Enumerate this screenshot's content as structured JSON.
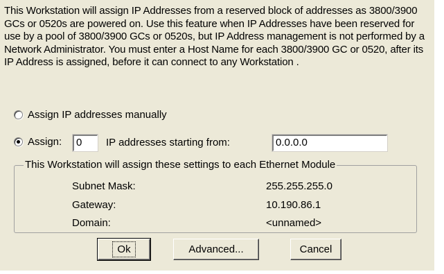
{
  "intro_text": "This Workstation will assign IP Addresses from a reserved block of addresses as 3800/3900 GCs or 0520s are powered on.  Use this feature when IP Addresses have been reserved for use by a pool of 3800/3900 GCs or 0520s, but IP Address management is not performed by a Network Administrator.  You must enter a Host Name for each 3800/3900 GC or 0520, after its IP Address is assigned, before it can connect to any Workstation .",
  "options": {
    "manual_label": "Assign IP addresses manually",
    "manual_selected": false,
    "auto_prefix_label": "Assign:",
    "auto_selected": true,
    "count_value": "0",
    "starting_from_label": "IP addresses starting from:",
    "start_ip_value": "0.0.0.0"
  },
  "settings_group": {
    "title": "This Workstation will assign these settings to each Ethernet Module",
    "rows": [
      {
        "label": "Subnet Mask:",
        "value": "255.255.255.0"
      },
      {
        "label": "Gateway:",
        "value": "10.190.86.1"
      },
      {
        "label": "Domain:",
        "value": "<unnamed>"
      }
    ]
  },
  "buttons": {
    "ok": "Ok",
    "advanced": "Advanced...",
    "cancel": "Cancel"
  }
}
